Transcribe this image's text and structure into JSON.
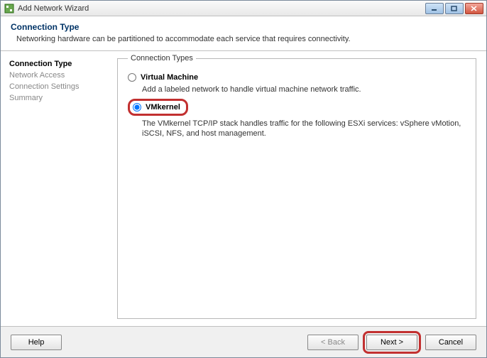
{
  "window": {
    "title": "Add Network Wizard"
  },
  "header": {
    "title": "Connection Type",
    "subtitle": "Networking hardware can be partitioned to accommodate each service that requires connectivity."
  },
  "nav": {
    "items": [
      {
        "label": "Connection Type",
        "active": true
      },
      {
        "label": "Network Access",
        "active": false
      },
      {
        "label": "Connection Settings",
        "active": false
      },
      {
        "label": "Summary",
        "active": false
      }
    ]
  },
  "content": {
    "legend": "Connection Types",
    "options": [
      {
        "id": "vm",
        "label": "Virtual Machine",
        "selected": false,
        "desc": "Add a labeled network to handle virtual machine network traffic."
      },
      {
        "id": "vmkernel",
        "label": "VMkernel",
        "selected": true,
        "desc": "The VMkernel TCP/IP stack handles traffic for the following ESXi services: vSphere vMotion, iSCSI, NFS, and host management."
      }
    ]
  },
  "footer": {
    "help": "Help",
    "back": "< Back",
    "next": "Next >",
    "cancel": "Cancel"
  }
}
